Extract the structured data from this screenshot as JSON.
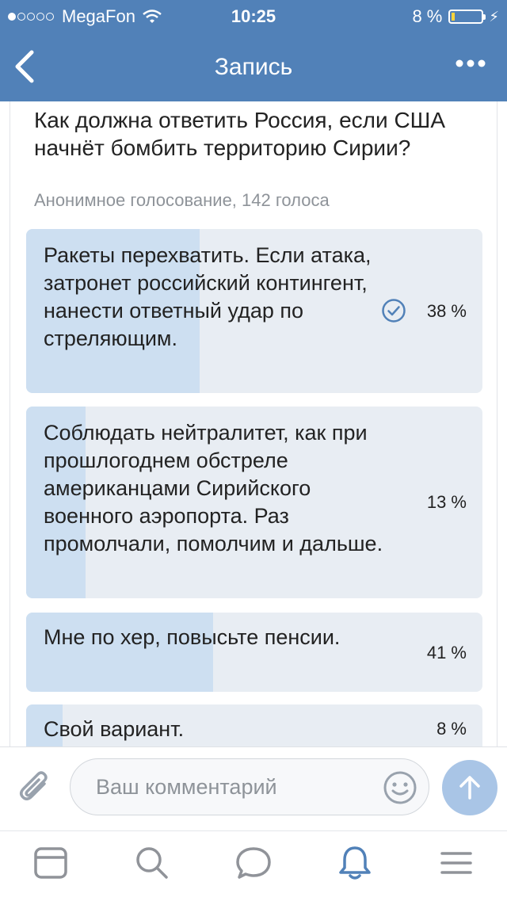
{
  "status": {
    "carrier": "MegaFon",
    "time": "10:25",
    "battery": "8 %"
  },
  "nav": {
    "title": "Запись"
  },
  "poll": {
    "question": "Как должна ответить Россия, если США начнёт бомбить территорию Сирии?",
    "meta": "Анонимное голосование, 142 голоса",
    "options": [
      {
        "text": "Ракеты перехватить. Если атака, затронет российский контингент, нанести ответный удар по стреляющим.",
        "percent": "38 %",
        "share": 0.38,
        "voted": true
      },
      {
        "text": "Соблюдать нейтралитет, как при прошлогоднем обстреле американцами Сирийского военного аэропорта. Раз промолчали, помолчим и дальше.",
        "percent": "13 %",
        "share": 0.13,
        "voted": false
      },
      {
        "text": "Мне по хер, повысьте пенсии.",
        "percent": "41 %",
        "share": 0.41,
        "voted": false
      },
      {
        "text": "Свой вариант.",
        "percent": "8 %",
        "share": 0.08,
        "voted": false
      }
    ]
  },
  "composer": {
    "placeholder": "Ваш комментарий"
  },
  "tabs": [
    "news-icon",
    "search-icon",
    "messages-icon",
    "notifications-icon",
    "menu-icon"
  ],
  "colors": {
    "brand": "#5181b8",
    "option_bg": "#e8edf3",
    "option_fill": "#cddff1",
    "send": "#a9c5e6"
  }
}
